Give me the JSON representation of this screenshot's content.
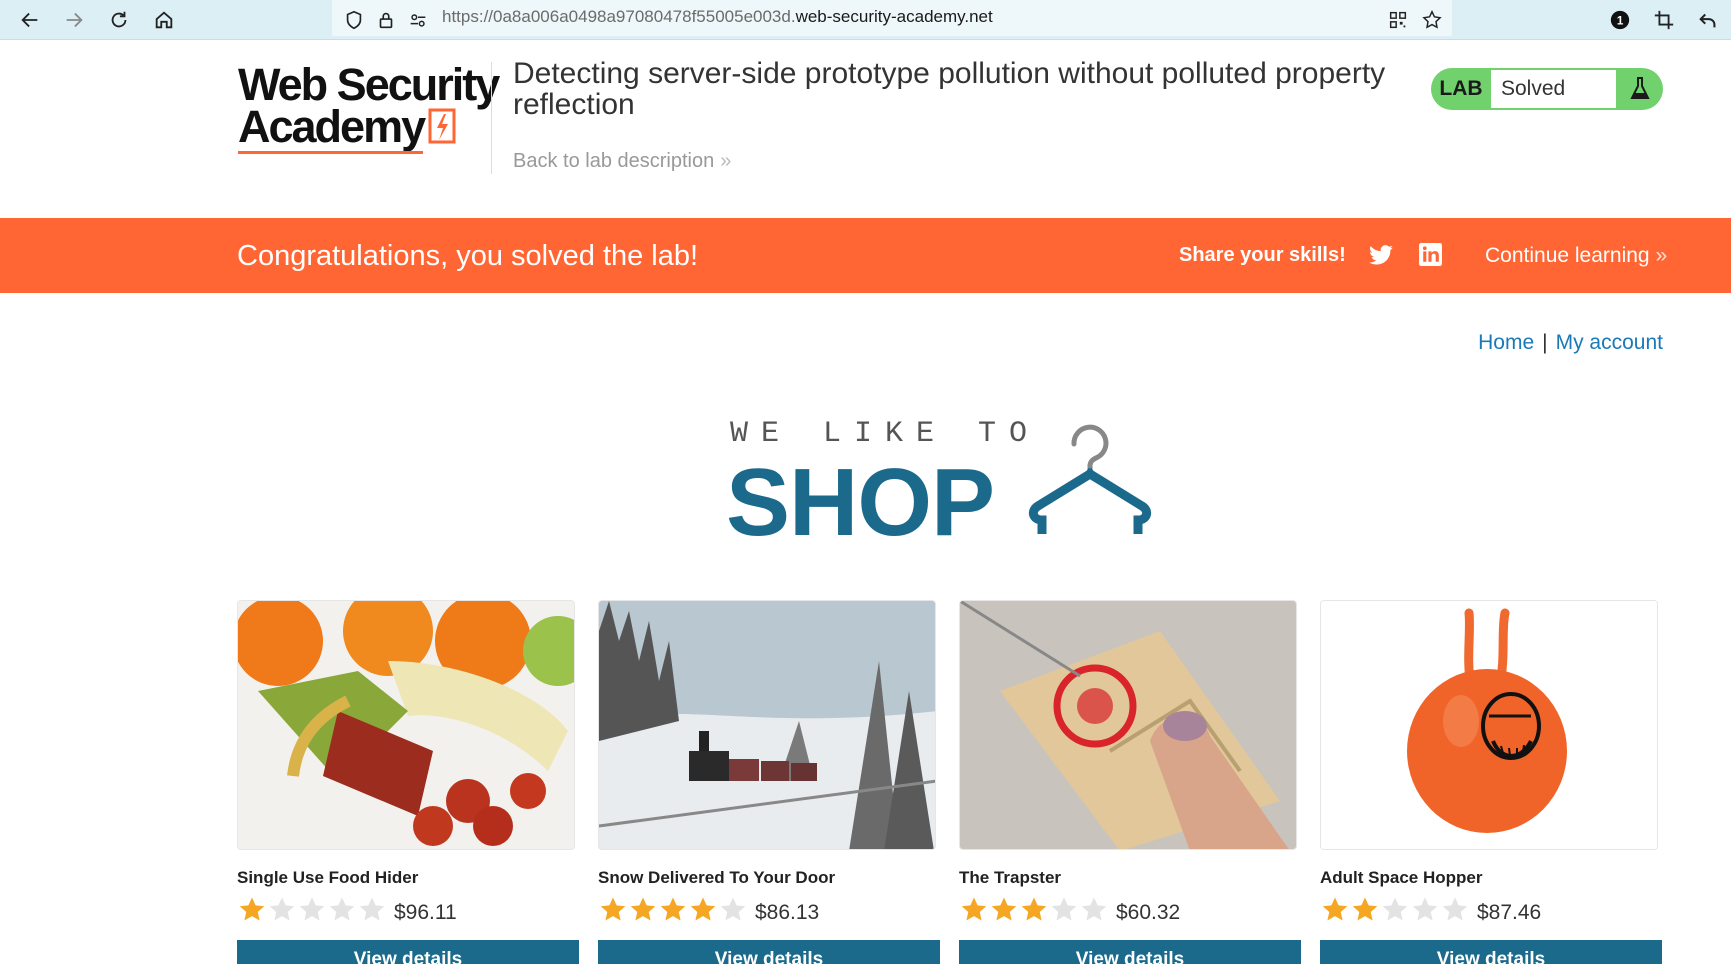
{
  "browser": {
    "url_prefix": "https://0a8a006a0498a97080478f55005e003d.",
    "url_domain": "web-security-academy.net",
    "notification_count": "1"
  },
  "header": {
    "logo_line1": "Web Security",
    "logo_line2": "Academy",
    "lab_title": "Detecting server-side prototype pollution without polluted property reflection",
    "back_link": "Back to lab description",
    "lab_badge_label": "LAB",
    "lab_status": "Solved"
  },
  "banner": {
    "message": "Congratulations, you solved the lab!",
    "share_label": "Share your skills!",
    "continue_label": "Continue learning"
  },
  "nav": {
    "home": "Home",
    "separator": "|",
    "account": "My account"
  },
  "hero": {
    "small_text": "WE LIKE TO",
    "big_text": "SHOP"
  },
  "colors": {
    "accent": "#ff6633",
    "brand_blue": "#1b6a8c",
    "lab_green": "#70d16d",
    "link": "#1a7ab8",
    "star": "#f5a623"
  },
  "products": [
    {
      "name": "Single Use Food Hider",
      "rating": 1,
      "price": "$96.11",
      "button": "View details"
    },
    {
      "name": "Snow Delivered To Your Door",
      "rating": 4,
      "price": "$86.13",
      "button": "View details"
    },
    {
      "name": "The Trapster",
      "rating": 3,
      "price": "$60.32",
      "button": "View details"
    },
    {
      "name": "Adult Space Hopper",
      "rating": 2,
      "price": "$87.46",
      "button": "View details"
    }
  ]
}
